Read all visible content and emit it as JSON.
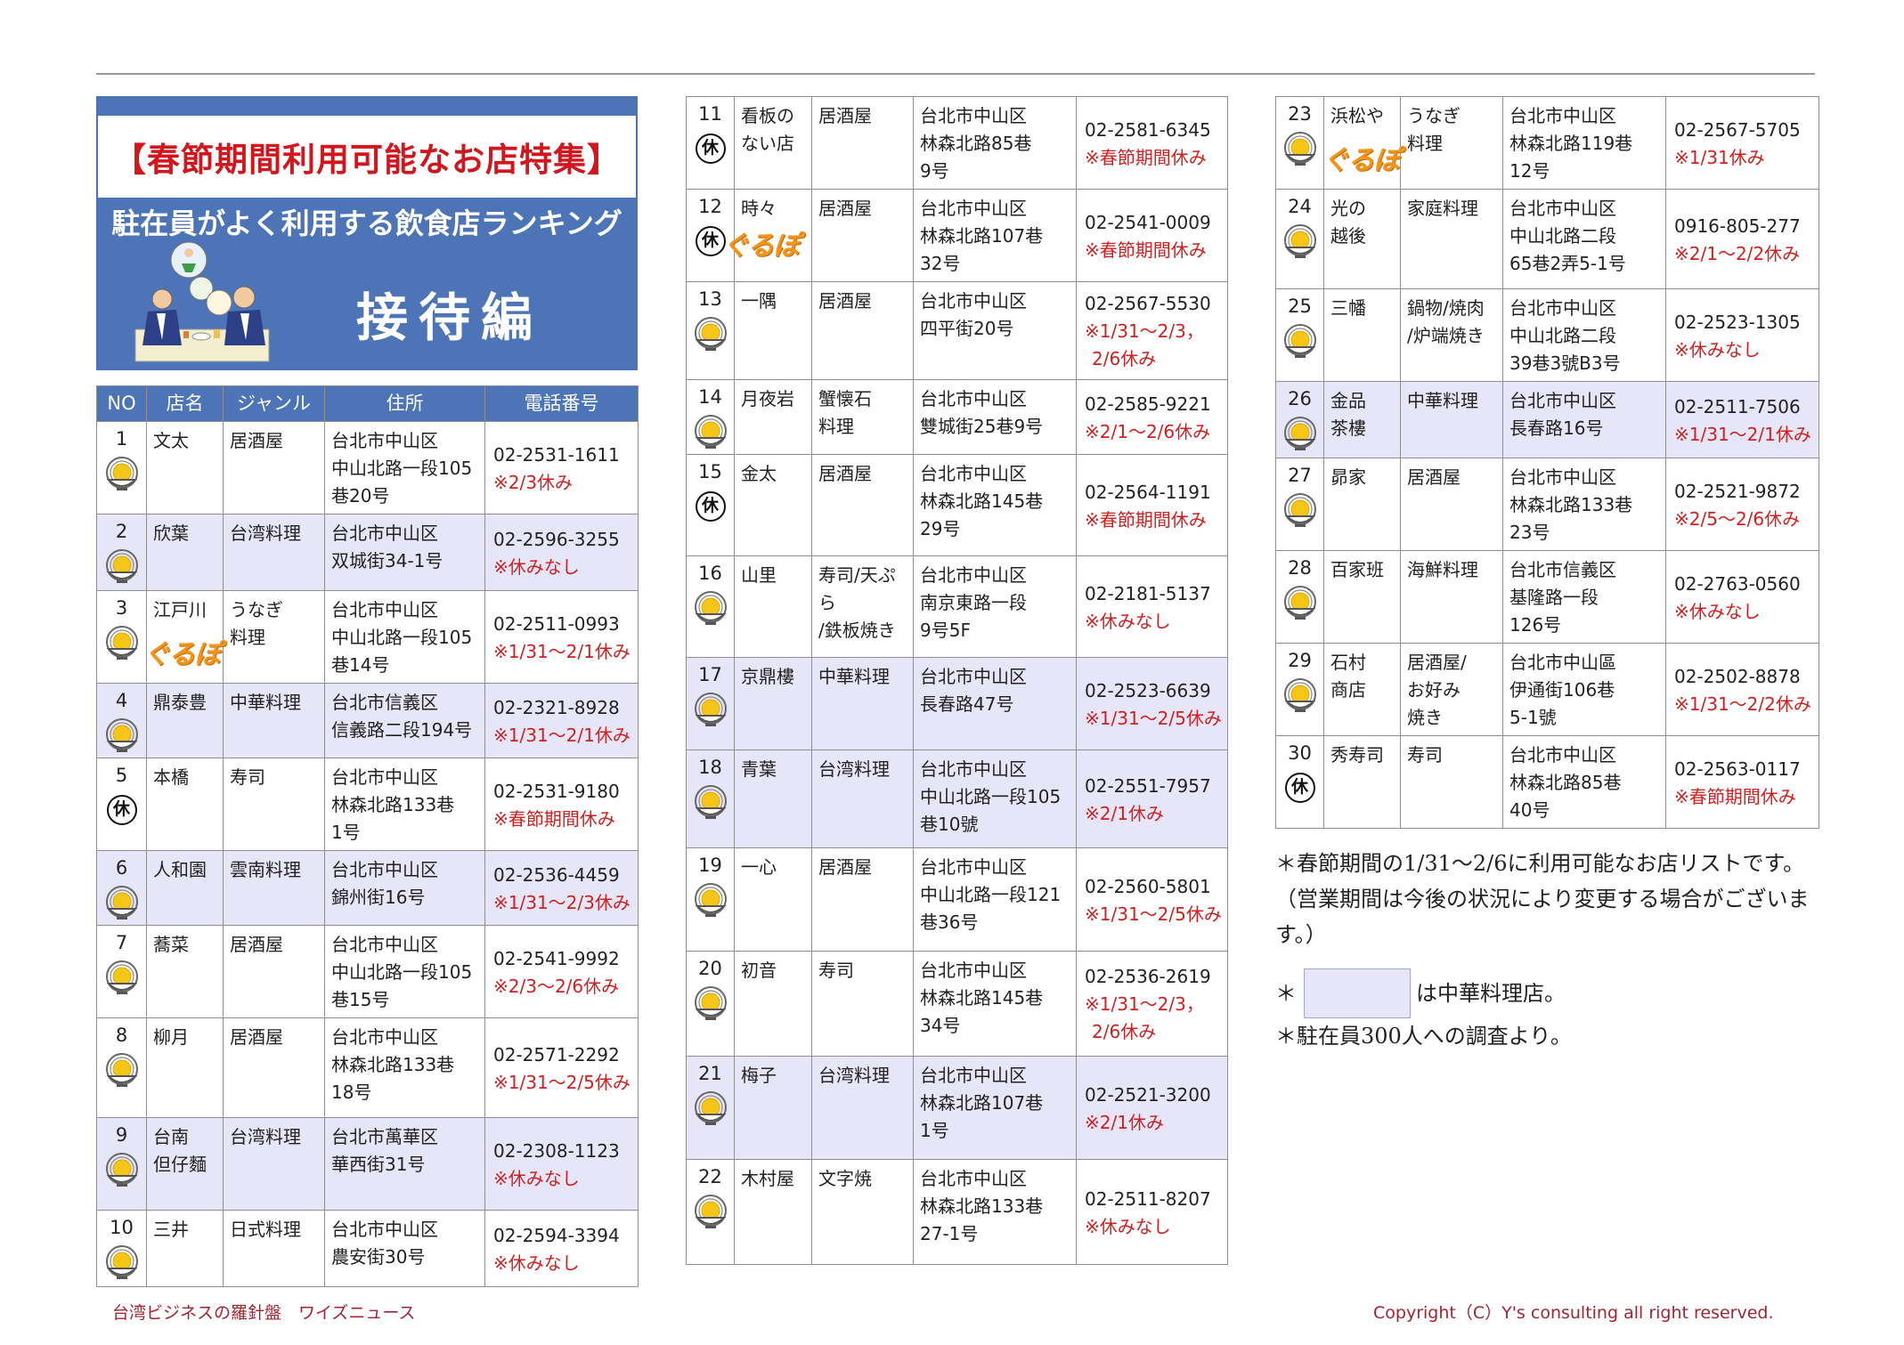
{
  "banner": {
    "special": "【春節期間利用可能なお店特集】",
    "subtitle": "駐在員がよく利用する飲食店ランキング",
    "main": "接待編"
  },
  "table_headers": [
    "NO",
    "店名",
    "ジャンル",
    "住所",
    "電話番号"
  ],
  "icon_labels": {
    "rest": "休",
    "gurunavi": "ぐるぽ"
  },
  "colors": {
    "header_bg": "#4d74b6",
    "chinese_row_bg": "#e6e6f8",
    "note_red": "#d22020",
    "footer": "#a32431"
  },
  "restaurants": [
    {
      "no": "1",
      "name": [
        "文太"
      ],
      "genre": [
        "居酒屋"
      ],
      "address": [
        "台北市中山区",
        "中山北路一段105",
        "巷20号"
      ],
      "tel": "02-2531-1611",
      "note": [
        "※2/3休み"
      ],
      "icon": "bowl-icon",
      "gurunavi": false,
      "chinese": false
    },
    {
      "no": "2",
      "name": [
        "欣葉"
      ],
      "genre": [
        "台湾料理"
      ],
      "address": [
        "台北市中山区",
        "双城街34-1号"
      ],
      "tel": "02-2596-3255",
      "note": [
        "※休みなし"
      ],
      "icon": "bowl-icon",
      "gurunavi": false,
      "chinese": true
    },
    {
      "no": "3",
      "name": [
        "江戸川"
      ],
      "genre": [
        "うなぎ",
        "料理"
      ],
      "address": [
        "台北市中山区",
        "中山北路一段105",
        "巷14号"
      ],
      "tel": "02-2511-0993",
      "note": [
        "※1/31〜2/1休み"
      ],
      "icon": "bowl-icon",
      "gurunavi": true,
      "chinese": false
    },
    {
      "no": "4",
      "name": [
        "鼎泰豊"
      ],
      "genre": [
        "中華料理"
      ],
      "address": [
        "台北市信義区",
        "信義路二段194号"
      ],
      "tel": "02-2321-8928",
      "note": [
        "※1/31〜2/1休み"
      ],
      "icon": "bowl-icon",
      "gurunavi": false,
      "chinese": true
    },
    {
      "no": "5",
      "name": [
        "本橋"
      ],
      "genre": [
        "寿司"
      ],
      "address": [
        "台北市中山区",
        "林森北路133巷",
        "1号"
      ],
      "tel": "02-2531-9180",
      "note": [
        "※春節期間休み"
      ],
      "icon": "rest-icon",
      "gurunavi": false,
      "chinese": false
    },
    {
      "no": "6",
      "name": [
        "人和園"
      ],
      "genre": [
        "雲南料理"
      ],
      "address": [
        "台北市中山区",
        "錦州街16号"
      ],
      "tel": "02-2536-4459",
      "note": [
        "※1/31〜2/3休み"
      ],
      "icon": "bowl-icon",
      "gurunavi": false,
      "chinese": true
    },
    {
      "no": "7",
      "name": [
        "蕎菜"
      ],
      "genre": [
        "居酒屋"
      ],
      "address": [
        "台北市中山区",
        "中山北路一段105",
        "巷15号"
      ],
      "tel": "02-2541-9992",
      "note": [
        "※2/3〜2/6休み"
      ],
      "icon": "bowl-icon",
      "gurunavi": false,
      "chinese": false
    },
    {
      "no": "8",
      "name": [
        "柳月"
      ],
      "genre": [
        "居酒屋"
      ],
      "address": [
        "台北市中山区",
        "林森北路133巷",
        "18号"
      ],
      "tel": "02-2571-2292",
      "note": [
        "※1/31〜2/5休み"
      ],
      "icon": "bowl-icon",
      "gurunavi": false,
      "chinese": false
    },
    {
      "no": "9",
      "name": [
        "台南",
        "但仔麵"
      ],
      "genre": [
        "台湾料理"
      ],
      "address": [
        "台北市萬華区",
        "華西街31号"
      ],
      "tel": "02-2308-1123",
      "note": [
        "※休みなし"
      ],
      "icon": "bowl-icon",
      "gurunavi": false,
      "chinese": true
    },
    {
      "no": "10",
      "name": [
        "三井"
      ],
      "genre": [
        "日式料理"
      ],
      "address": [
        "台北市中山区",
        "農安街30号"
      ],
      "tel": "02-2594-3394",
      "note": [
        "※休みなし"
      ],
      "icon": "bowl-icon",
      "gurunavi": false,
      "chinese": false
    },
    {
      "no": "11",
      "name": [
        "看板の",
        "ない店"
      ],
      "genre": [
        "居酒屋"
      ],
      "address": [
        "台北市中山区",
        "林森北路85巷",
        "9号"
      ],
      "tel": "02-2581-6345",
      "note": [
        "※春節期間休み"
      ],
      "icon": "rest-icon",
      "gurunavi": false,
      "chinese": false
    },
    {
      "no": "12",
      "name": [
        "時々"
      ],
      "genre": [
        "居酒屋"
      ],
      "address": [
        "台北市中山区",
        "林森北路107巷",
        "32号"
      ],
      "tel": "02-2541-0009",
      "note": [
        "※春節期間休み"
      ],
      "icon": "rest-icon",
      "gurunavi": true,
      "chinese": false
    },
    {
      "no": "13",
      "name": [
        "一隅"
      ],
      "genre": [
        "居酒屋"
      ],
      "address": [
        "台北市中山区",
        "四平街20号"
      ],
      "tel": "02-2567-5530",
      "note": [
        "※1/31〜2/3，",
        "2/6休み"
      ],
      "icon": "bowl-icon",
      "gurunavi": false,
      "chinese": false
    },
    {
      "no": "14",
      "name": [
        "月夜岩"
      ],
      "genre": [
        "蟹懐石",
        "料理"
      ],
      "address": [
        "台北市中山区",
        "雙城街25巷9号"
      ],
      "tel": "02-2585-9221",
      "note": [
        "※2/1〜2/6休み"
      ],
      "icon": "bowl-icon",
      "gurunavi": false,
      "chinese": false
    },
    {
      "no": "15",
      "name": [
        "金太"
      ],
      "genre": [
        "居酒屋"
      ],
      "address": [
        "台北市中山区",
        "林森北路145巷",
        "29号"
      ],
      "tel": "02-2564-1191",
      "note": [
        "※春節期間休み"
      ],
      "icon": "rest-icon",
      "gurunavi": false,
      "chinese": false
    },
    {
      "no": "16",
      "name": [
        "山里"
      ],
      "genre": [
        "寿司/天ぷ",
        "ら",
        "/鉄板焼き"
      ],
      "address": [
        "台北市中山区",
        "南京東路一段",
        "9号5F"
      ],
      "tel": "02-2181-5137",
      "note": [
        "※休みなし"
      ],
      "icon": "bowl-icon",
      "gurunavi": false,
      "chinese": false
    },
    {
      "no": "17",
      "name": [
        "京鼎樓"
      ],
      "genre": [
        "中華料理"
      ],
      "address": [
        "台北市中山区",
        "長春路47号"
      ],
      "tel": "02-2523-6639",
      "note": [
        "※1/31〜2/5休み"
      ],
      "icon": "bowl-icon",
      "gurunavi": false,
      "chinese": true
    },
    {
      "no": "18",
      "name": [
        "青葉"
      ],
      "genre": [
        "台湾料理"
      ],
      "address": [
        "台北市中山区",
        "中山北路一段105",
        "巷10號"
      ],
      "tel": "02-2551-7957",
      "note": [
        "※2/1休み"
      ],
      "icon": "bowl-icon",
      "gurunavi": false,
      "chinese": true
    },
    {
      "no": "19",
      "name": [
        "一心"
      ],
      "genre": [
        "居酒屋"
      ],
      "address": [
        "台北市中山区",
        "中山北路一段121",
        "巷36号"
      ],
      "tel": "02-2560-5801",
      "note": [
        "※1/31〜2/5休み"
      ],
      "icon": "bowl-icon",
      "gurunavi": false,
      "chinese": false
    },
    {
      "no": "20",
      "name": [
        "初音"
      ],
      "genre": [
        "寿司"
      ],
      "address": [
        "台北市中山区",
        "林森北路145巷",
        "34号"
      ],
      "tel": "02-2536-2619",
      "note": [
        "※1/31〜2/3，",
        "2/6休み"
      ],
      "icon": "bowl-icon",
      "gurunavi": false,
      "chinese": false
    },
    {
      "no": "21",
      "name": [
        "梅子"
      ],
      "genre": [
        "台湾料理"
      ],
      "address": [
        "台北市中山区",
        "林森北路107巷",
        "1号"
      ],
      "tel": "02-2521-3200",
      "note": [
        "※2/1休み"
      ],
      "icon": "bowl-icon",
      "gurunavi": false,
      "chinese": true
    },
    {
      "no": "22",
      "name": [
        "木村屋"
      ],
      "genre": [
        "文字焼"
      ],
      "address": [
        "台北市中山区",
        "林森北路133巷",
        "27-1号"
      ],
      "tel": "02-2511-8207",
      "note": [
        "※休みなし"
      ],
      "icon": "bowl-icon",
      "gurunavi": false,
      "chinese": false
    },
    {
      "no": "23",
      "name": [
        "浜松や"
      ],
      "genre": [
        "うなぎ",
        "料理"
      ],
      "address": [
        "台北市中山区",
        "林森北路119巷",
        "12号"
      ],
      "tel": "02-2567-5705",
      "note": [
        "※1/31休み"
      ],
      "icon": "bowl-icon",
      "gurunavi": true,
      "chinese": false
    },
    {
      "no": "24",
      "name": [
        "光の",
        "越後"
      ],
      "genre": [
        "家庭料理"
      ],
      "address": [
        "台北市中山区",
        "中山北路二段",
        "65巷2弄5-1号"
      ],
      "tel": "0916-805-277",
      "note": [
        "※2/1〜2/2休み"
      ],
      "icon": "bowl-icon",
      "gurunavi": false,
      "chinese": false
    },
    {
      "no": "25",
      "name": [
        "三幡"
      ],
      "genre": [
        "鍋物/焼肉",
        "/炉端焼き"
      ],
      "address": [
        "台北市中山区",
        "中山北路二段",
        "39巷3號B3号"
      ],
      "tel": "02-2523-1305",
      "note": [
        "※休みなし"
      ],
      "icon": "bowl-icon",
      "gurunavi": false,
      "chinese": false
    },
    {
      "no": "26",
      "name": [
        "金品",
        "茶樓"
      ],
      "genre": [
        "中華料理"
      ],
      "address": [
        "台北市中山区",
        "長春路16号"
      ],
      "tel": "02-2511-7506",
      "note": [
        "※1/31〜2/1休み"
      ],
      "icon": "bowl-icon",
      "gurunavi": false,
      "chinese": true
    },
    {
      "no": "27",
      "name": [
        "昴家"
      ],
      "genre": [
        "居酒屋"
      ],
      "address": [
        "台北市中山区",
        "林森北路133巷",
        "23号"
      ],
      "tel": "02-2521-9872",
      "note": [
        "※2/5〜2/6休み"
      ],
      "icon": "bowl-icon",
      "gurunavi": false,
      "chinese": false
    },
    {
      "no": "28",
      "name": [
        "百家班"
      ],
      "genre": [
        "海鮮料理"
      ],
      "address": [
        "台北市信義区",
        "基隆路一段",
        "126号"
      ],
      "tel": "02-2763-0560",
      "note": [
        "※休みなし"
      ],
      "icon": "bowl-icon",
      "gurunavi": false,
      "chinese": false
    },
    {
      "no": "29",
      "name": [
        "石村",
        "商店"
      ],
      "genre": [
        "居酒屋/",
        "お好み",
        "焼き"
      ],
      "address": [
        "台北市中山區",
        "伊通街106巷",
        "5-1號"
      ],
      "tel": "02-2502-8878",
      "note": [
        "※1/31〜2/2休み"
      ],
      "icon": "bowl-icon",
      "gurunavi": false,
      "chinese": false
    },
    {
      "no": "30",
      "name": [
        "秀寿司"
      ],
      "genre": [
        "寿司"
      ],
      "address": [
        "台北市中山区",
        "林森北路85巷",
        "40号"
      ],
      "tel": "02-2563-0117",
      "note": [
        "※春節期間休み"
      ],
      "icon": "rest-icon",
      "gurunavi": false,
      "chinese": false
    }
  ],
  "notes": {
    "line1": "＊春節期間の1/31〜2/6に利用可能なお店リストです。",
    "line2": "（営業期間は今後の状況により変更する場合がございます。）",
    "legend_prefix": "＊",
    "legend_text": "は中華料理店。",
    "line4": "＊駐在員300人への調査より。"
  },
  "footer": {
    "left": "台湾ビジネスの羅針盤　ワイズニュース",
    "right": "Copyright（C）Y's consulting all right reserved."
  }
}
